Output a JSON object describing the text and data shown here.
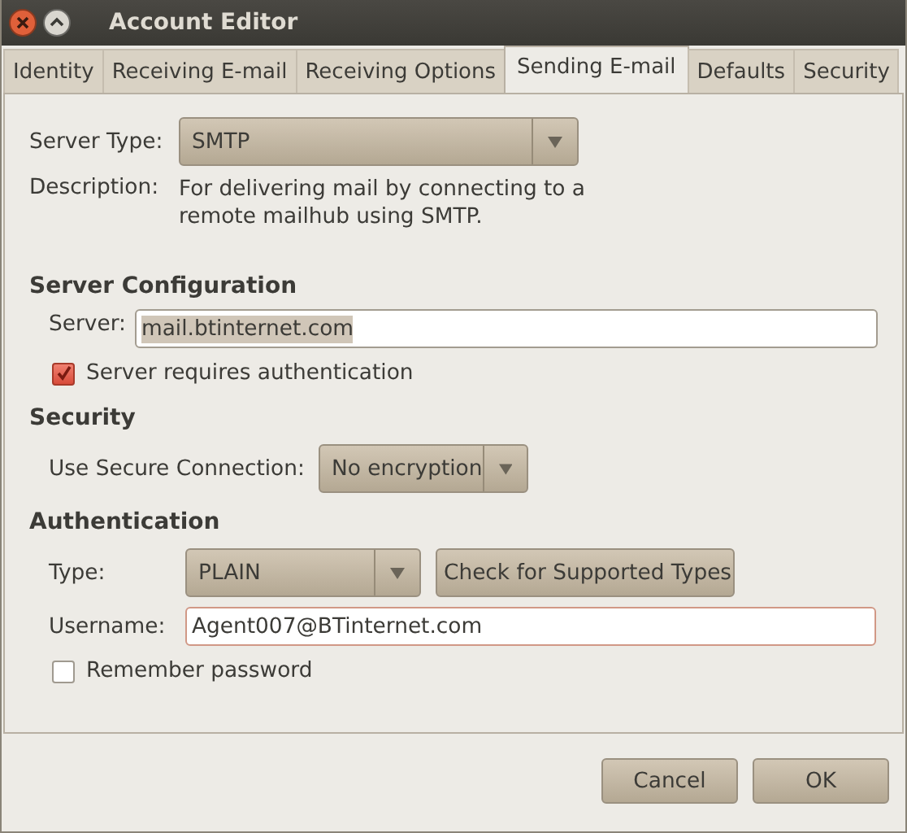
{
  "window": {
    "title": "Account Editor"
  },
  "tabs": [
    {
      "label": "Identity",
      "selected": false
    },
    {
      "label": "Receiving E-mail",
      "selected": false
    },
    {
      "label": "Receiving Options",
      "selected": false
    },
    {
      "label": "Sending E-mail",
      "selected": true
    },
    {
      "label": "Defaults",
      "selected": false
    },
    {
      "label": "Security",
      "selected": false
    }
  ],
  "server_type": {
    "label": "Server Type:",
    "value": "SMTP"
  },
  "description": {
    "label": "Description:",
    "text": "For delivering mail by connecting to a remote mailhub using SMTP."
  },
  "server_configuration": {
    "heading": "Server Configuration",
    "server": {
      "label": "Server:",
      "value": "mail.btinternet.com",
      "highlighted": true
    },
    "requires_auth": {
      "label": "Server requires authentication",
      "checked": true
    }
  },
  "security": {
    "heading": "Security",
    "secure_connection": {
      "label": "Use Secure Connection:",
      "value": "No encryption"
    }
  },
  "authentication": {
    "heading": "Authentication",
    "type": {
      "label": "Type:",
      "value": "PLAIN"
    },
    "check_button": "Check for Supported Types",
    "username": {
      "label": "Username:",
      "value": "Agent007@BTinternet.com",
      "focused": true
    },
    "remember_password": {
      "label": "Remember password",
      "checked": false
    }
  },
  "buttons": [
    "Cancel",
    "OK"
  ]
}
